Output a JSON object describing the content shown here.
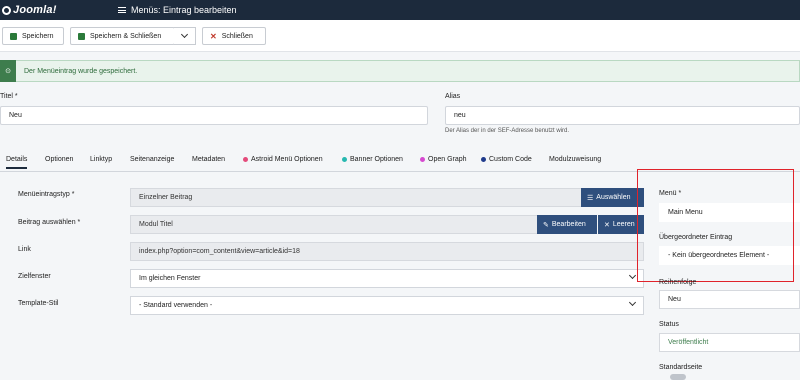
{
  "header": {
    "logo_text": "Joomla!",
    "page_title": "Menüs: Eintrag bearbeiten"
  },
  "toolbar": {
    "save_label": "Speichern",
    "save_close_label": "Speichern & Schließen",
    "close_label": "Schließen"
  },
  "alert": {
    "message": "Der Menüeintrag wurde gespeichert."
  },
  "form": {
    "title_label": "Titel *",
    "title_value": "Neu",
    "alias_label": "Alias",
    "alias_value": "neu",
    "alias_hint": "Der Alias der in der SEF-Adresse benutzt wird."
  },
  "tabs": [
    {
      "label": "Details"
    },
    {
      "label": "Optionen"
    },
    {
      "label": "Linktyp"
    },
    {
      "label": "Seitenanzeige"
    },
    {
      "label": "Metadaten"
    },
    {
      "label": "Astroid Menü Optionen",
      "dot": "#e44b7b"
    },
    {
      "label": "Banner Optionen",
      "dot": "#27b8b0"
    },
    {
      "label": "Open Graph",
      "dot": "#d64ad0"
    },
    {
      "label": "Custom Code",
      "dot": "#1f3b8c"
    },
    {
      "label": "Modulzuweisung"
    }
  ],
  "details": {
    "menu_item_type_label": "Menüeintragstyp *",
    "menu_item_type_value": "Einzelner Beitrag",
    "select_button": "Auswählen",
    "article_label": "Beitrag auswählen *",
    "article_value": "Modul Titel",
    "edit_button": "Bearbeiten",
    "clear_button": "Leeren",
    "link_label": "Link",
    "link_value": "index.php?option=com_content&view=article&id=18",
    "target_label": "Zielfenster",
    "target_value": "Im gleichen Fenster",
    "template_label": "Template-Stil",
    "template_value": "- Standard verwenden -"
  },
  "sidebar": {
    "menu_label": "Menü *",
    "menu_value": "Main Menu",
    "parent_label": "Übergeordneter Eintrag",
    "parent_value": "- Kein übergeordnetes Element -",
    "order_label": "Reihenfolge",
    "order_value": "Neu",
    "status_label": "Status",
    "status_value": "Veröffentlicht",
    "default_label": "Standardseite"
  },
  "colors": {
    "header_bg": "#1c2a3c",
    "primary_blue": "#2f4f7d",
    "success_green": "#3e7d4d",
    "highlight_red": "#e0232b"
  }
}
